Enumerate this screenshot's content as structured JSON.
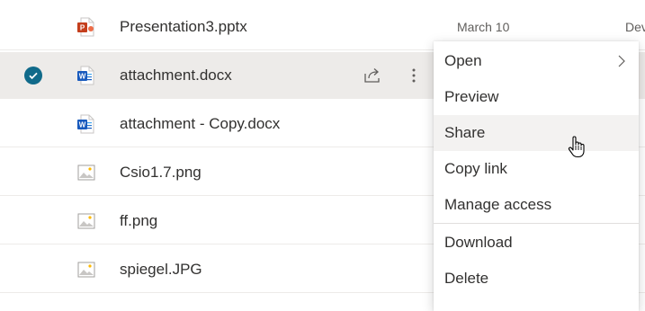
{
  "files": [
    {
      "name": "Presentation3.pptx",
      "type": "pptx",
      "date": "March 10",
      "modified_by": "Dev",
      "selected": false
    },
    {
      "name": "attachment.docx",
      "type": "docx",
      "date": "",
      "modified_by": "",
      "selected": true
    },
    {
      "name": "attachment - Copy.docx",
      "type": "docx",
      "date": "",
      "modified_by": "",
      "selected": false
    },
    {
      "name": "Csio1.7.png",
      "type": "png",
      "date": "",
      "modified_by": "",
      "selected": false
    },
    {
      "name": "ff.png",
      "type": "png",
      "date": "",
      "modified_by": "",
      "selected": false
    },
    {
      "name": "spiegel.JPG",
      "type": "jpg",
      "date": "",
      "modified_by": "",
      "selected": false
    }
  ],
  "context_menu": {
    "items": [
      {
        "label": "Open",
        "has_submenu": true
      },
      {
        "label": "Preview"
      },
      {
        "label": "Share",
        "hovered": true
      },
      {
        "label": "Copy link"
      },
      {
        "label": "Manage access"
      },
      {
        "label": "Download"
      },
      {
        "label": "Delete"
      }
    ]
  },
  "colors": {
    "accent": "#106a8a",
    "selected_row": "#edebe9",
    "hover_item": "#f3f2f1",
    "word_blue": "#185abd",
    "powerpoint_red": "#c43e1c"
  }
}
